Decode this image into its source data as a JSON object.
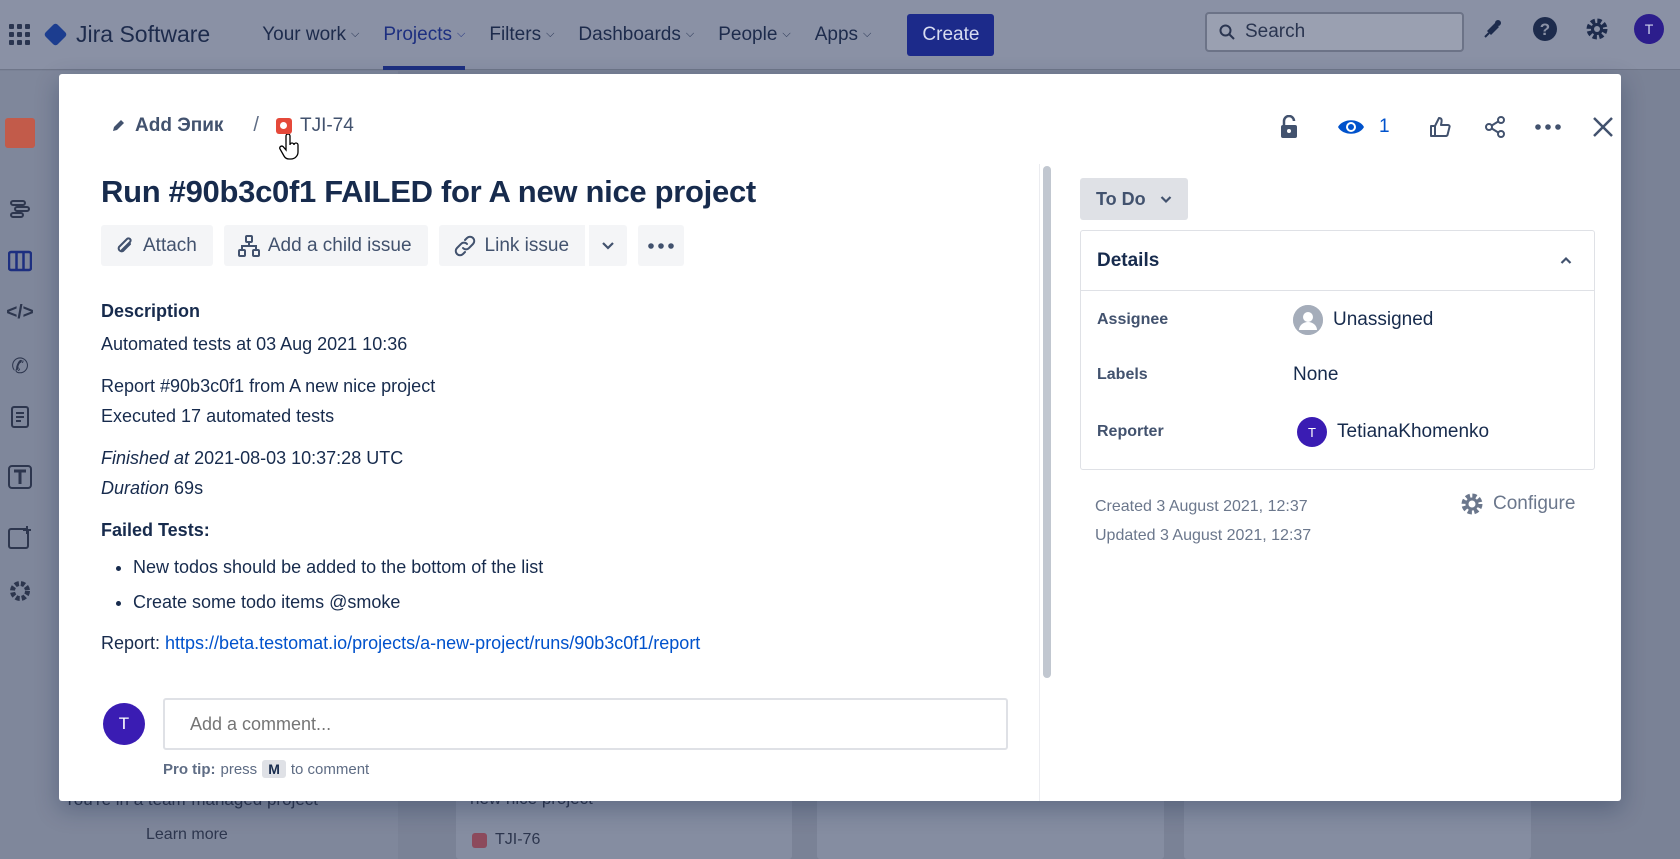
{
  "nav": {
    "product": "Jira Software",
    "items": [
      {
        "label": "Your work"
      },
      {
        "label": "Projects"
      },
      {
        "label": "Filters"
      },
      {
        "label": "Dashboards"
      },
      {
        "label": "People"
      },
      {
        "label": "Apps"
      }
    ],
    "create_label": "Create",
    "search_placeholder": "Search",
    "user_initial": "T"
  },
  "backdrop": {
    "team_managed_text": "You're in a team-managed project",
    "learn_more": "Learn more",
    "card_title": "new nice project",
    "card_key": "TJI-76"
  },
  "issue": {
    "breadcrumb_epic": "Add Эпик",
    "breadcrumb_separator": "/",
    "key": "TJI-74",
    "watchers": "1",
    "summary": "Run #90b3c0f1 FAILED for A new nice project",
    "toolbar": {
      "attach": "Attach",
      "add_child": "Add a child issue",
      "link_issue": "Link issue"
    },
    "description": {
      "heading": "Description",
      "automated_line": "Automated tests at 03 Aug 2021 10:36",
      "report_line": "Report #90b3c0f1 from A new nice project",
      "executed_line": "Executed 17 automated tests",
      "finished_label": "Finished at",
      "finished_value": " 2021-08-03 10:37:28 UTC",
      "duration_label": "Duration",
      "duration_value": " 69s",
      "failed_heading": "Failed Tests:",
      "failed_tests": [
        "New todos should be added to the bottom of the list",
        "Create some todo items @smoke"
      ],
      "report_label": "Report: ",
      "report_url": "https://beta.testomat.io/projects/a-new-project/runs/90b3c0f1/report"
    },
    "comment": {
      "avatar_initial": "T",
      "placeholder": "Add a comment...",
      "protip_label": "Pro tip:",
      "protip_press": "press",
      "protip_key": "M",
      "protip_suffix": "to comment"
    },
    "status": "To Do",
    "details": {
      "heading": "Details",
      "assignee_label": "Assignee",
      "assignee_value": "Unassigned",
      "labels_label": "Labels",
      "labels_value": "None",
      "reporter_label": "Reporter",
      "reporter_initial": "T",
      "reporter_value": "TetianaKhomenko"
    },
    "created": "Created 3 August 2021, 12:37",
    "updated": "Updated 3 August 2021, 12:37",
    "configure": "Configure"
  },
  "colors": {
    "accent": "#0052cc",
    "create_button": "#1c2a8a",
    "avatar": "#3a1cb3",
    "bug_type": "#e5493a"
  },
  "icons": [
    "app-switcher-icon",
    "jira-logo-icon",
    "search-icon",
    "notification-icon",
    "help-icon",
    "settings-icon",
    "pencil-icon",
    "bug-icon",
    "lock-icon",
    "eye-icon",
    "thumbs-up-icon",
    "share-icon",
    "more-icon",
    "close-icon",
    "paperclip-icon",
    "child-issue-icon",
    "link-icon",
    "chevron-down-icon",
    "chevron-up-icon",
    "user-icon",
    "gear-icon"
  ]
}
